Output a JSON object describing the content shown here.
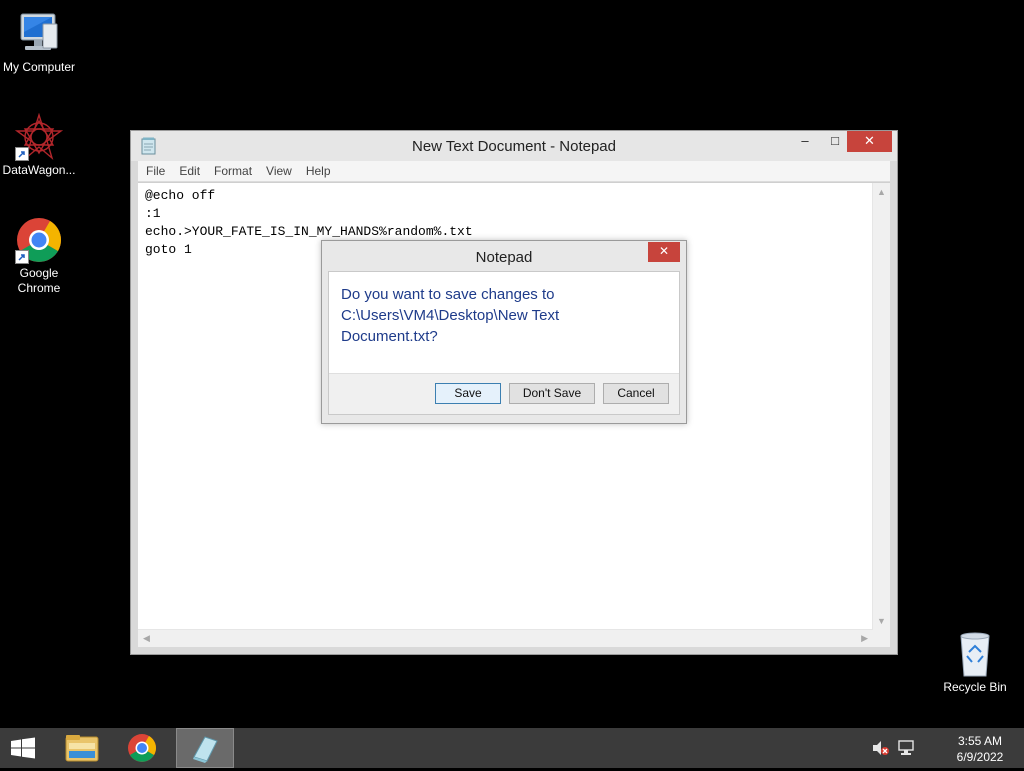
{
  "desktop": {
    "icons": [
      {
        "label": "My Computer",
        "icon": "computer-icon"
      },
      {
        "label": "DataWagon...",
        "icon": "datawagon-icon"
      },
      {
        "label": "Google Chrome",
        "icon": "chrome-icon"
      },
      {
        "label": "Recycle Bin",
        "icon": "recycle-bin-icon"
      }
    ]
  },
  "notepad": {
    "title": "New Text Document - Notepad",
    "menu": [
      "File",
      "Edit",
      "Format",
      "View",
      "Help"
    ],
    "content": "@echo off\n:1\necho.>YOUR_FATE_IS_IN_MY_HANDS%random%.txt\ngoto 1",
    "window_buttons": {
      "minimize": "–",
      "maximize": "□",
      "close": "✕"
    }
  },
  "dialog": {
    "title": "Notepad",
    "message": "Do you want to save changes to C:\\Users\\VM4\\Desktop\\New Text Document.txt?",
    "buttons": {
      "save": "Save",
      "dont_save": "Don't Save",
      "cancel": "Cancel"
    },
    "close_glyph": "✕"
  },
  "taskbar": {
    "items": [
      "start-icon",
      "file-explorer-icon",
      "chrome-icon",
      "notepad-icon"
    ],
    "active_item": "notepad-icon",
    "tray": [
      "speaker-muted-icon",
      "network-icon"
    ],
    "time": "3:55 AM",
    "date": "6/9/2022"
  },
  "colors": {
    "desktop_bg": "#000000",
    "close_button": "#c7443c",
    "dialog_text": "#1e3b8a",
    "taskbar": "#3b3b3b"
  }
}
